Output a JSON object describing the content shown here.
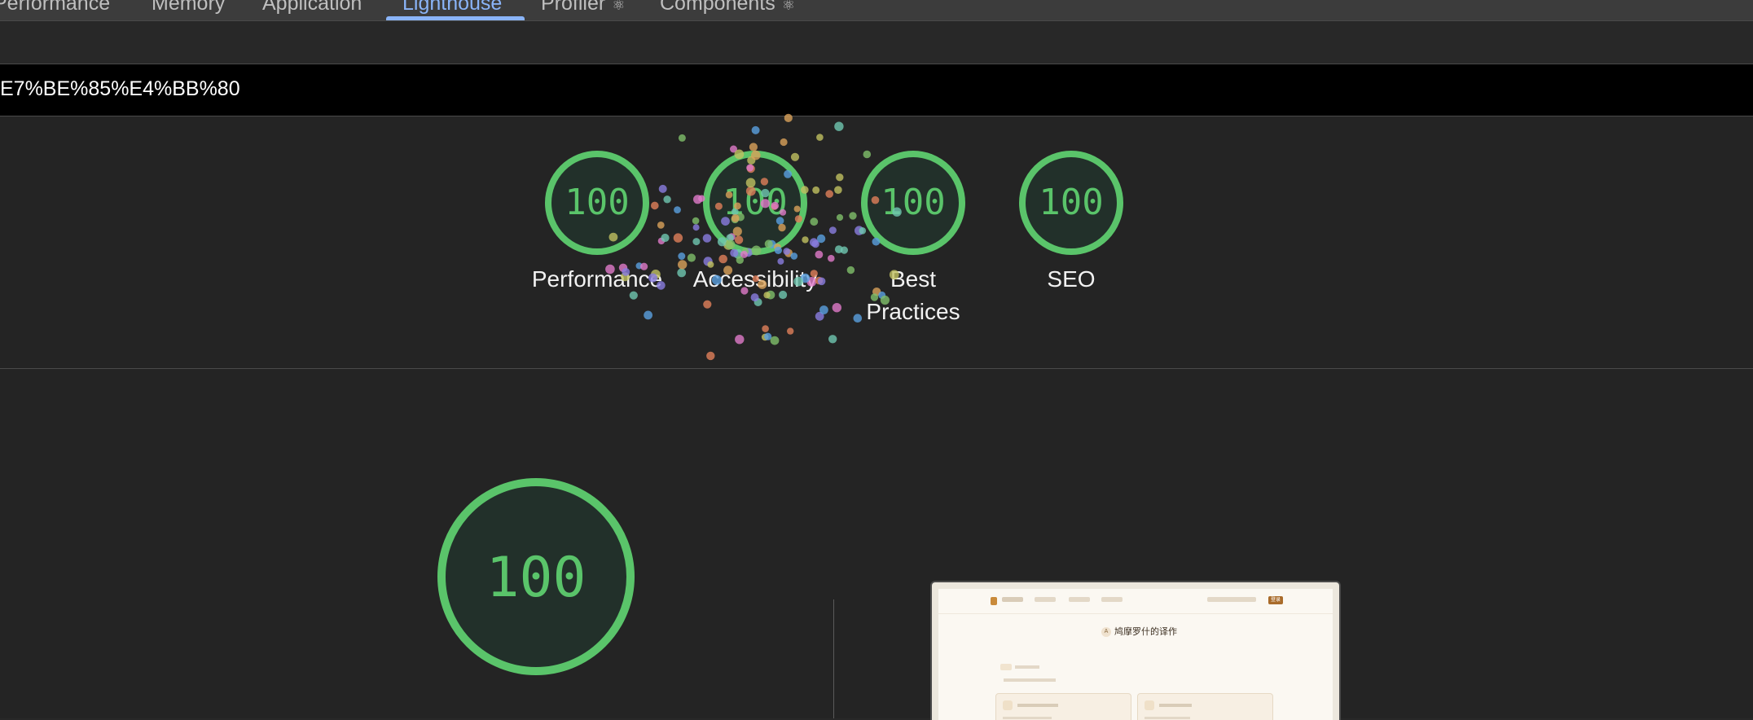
{
  "tabs": [
    {
      "label": "Performance",
      "active": false
    },
    {
      "label": "Memory",
      "active": false
    },
    {
      "label": "Application",
      "active": false
    },
    {
      "label": "Lighthouse",
      "active": true
    },
    {
      "label": "Profiler",
      "active": false,
      "icon": "react-atom-icon"
    },
    {
      "label": "Components",
      "active": false,
      "icon": "react-atom-icon"
    }
  ],
  "url": {
    "text": "E7%BE%85%E4%BB%80"
  },
  "scores": [
    {
      "value": "100",
      "label": "Performance"
    },
    {
      "value": "100",
      "label": "Accessibility"
    },
    {
      "value": "100",
      "label": "Best Practices"
    },
    {
      "value": "100",
      "label": "SEO"
    }
  ],
  "detail": {
    "score": "100",
    "screenshot": {
      "title": "鸠摩罗什的译作",
      "title_icon": "A",
      "button": "登录"
    }
  },
  "colors": {
    "pass": "#5ac46a",
    "gauge_fill": "#22302a",
    "accent": "#8ab4f8"
  }
}
